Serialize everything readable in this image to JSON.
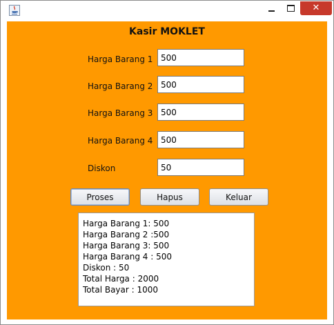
{
  "window": {
    "title": "",
    "close_glyph": "✕"
  },
  "form": {
    "heading": "Kasir MOKLET",
    "fields": [
      {
        "label": "Harga Barang 1",
        "value": "500"
      },
      {
        "label": "Harga Barang 2",
        "value": "500"
      },
      {
        "label": "Harga Barang 3",
        "value": "500"
      },
      {
        "label": "Harga Barang 4",
        "value": "500"
      },
      {
        "label": "Diskon",
        "value": "50"
      }
    ]
  },
  "buttons": {
    "process": "Proses",
    "clear": "Hapus",
    "exit": "Keluar"
  },
  "output": {
    "lines": [
      "Harga Barang 1: 500",
      "Harga Barang 2 :500",
      "Harga Barang 3: 500",
      "Harga Barang 4 : 500",
      "Diskon : 50",
      "Total Harga : 2000",
      "Total Bayar : 1000"
    ]
  },
  "colors": {
    "panel_background": "#ff9900",
    "window_background": "#ffffff",
    "close_button": "#c7392b"
  },
  "icons": {
    "app_icon": "java-icon",
    "minimize": "minimize-icon",
    "maximize": "maximize-icon",
    "close": "close-icon"
  }
}
